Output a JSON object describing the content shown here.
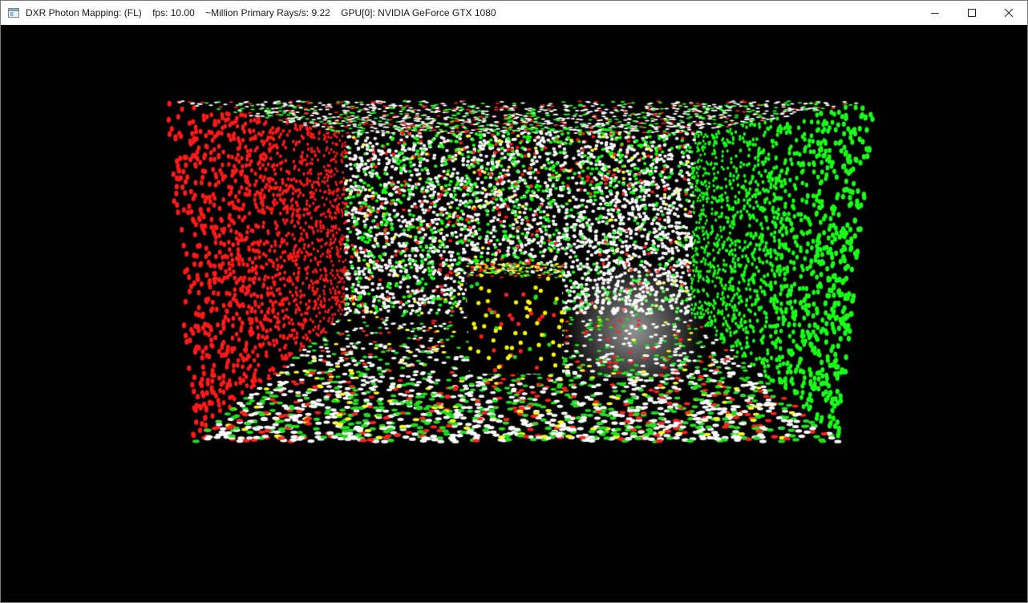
{
  "window": {
    "title": "DXR Photon Mapping: (FL)    fps: 10.00    ~Million Primary Rays/s: 9.22    GPU[0]: NVIDIA GeForce GTX 1080",
    "icons": {
      "app": "app-window-icon",
      "minimize": "minimize-icon",
      "maximize": "maximize-icon",
      "close": "close-icon"
    }
  },
  "scene": {
    "description_type": "cornell-box photon visualization",
    "colors": {
      "background": "#000000",
      "left_wall": "#ff1a1a",
      "right_wall": "#19ff19",
      "back_wall": "#ffffff",
      "floor_mix": [
        "#ffffff",
        "#20e020",
        "#ff2020",
        "#ffff20"
      ],
      "box_photons": [
        "#ffff00",
        "#ff2020",
        "#20e020"
      ]
    }
  }
}
